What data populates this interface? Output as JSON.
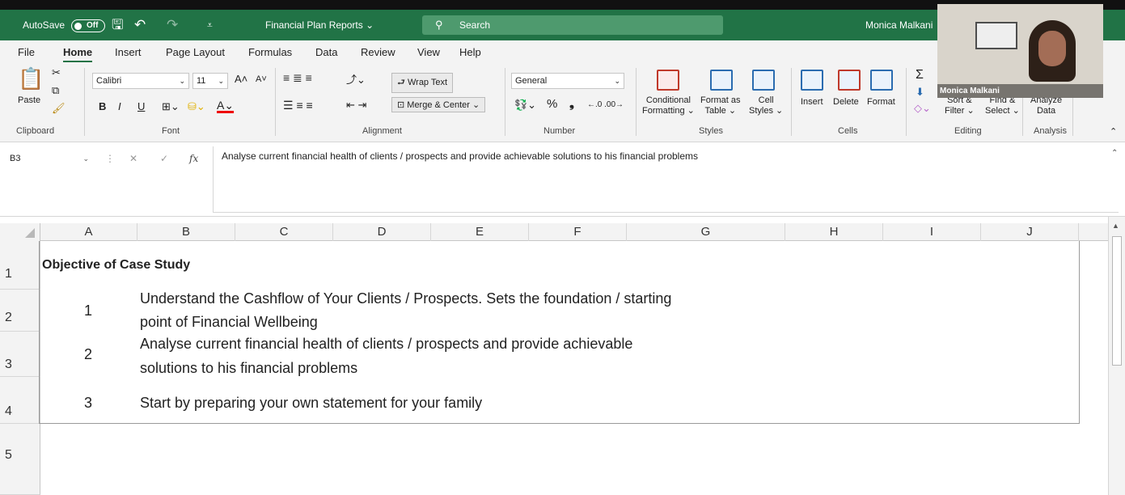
{
  "titlebar": {
    "autosave_label": "AutoSave",
    "autosave_state": "Off",
    "doc_title": "Financial Plan Reports",
    "doc_title_chevron": "⌄",
    "search_placeholder": "Search",
    "user_name": "Monica Malkani",
    "bg_color": "#217346"
  },
  "menu": [
    "File",
    "Home",
    "Insert",
    "Page Layout",
    "Formulas",
    "Data",
    "Review",
    "View",
    "Help"
  ],
  "menu_active": "Home",
  "ribbon": {
    "clipboard": {
      "paste": "Paste",
      "group": "Clipboard"
    },
    "font": {
      "name": "Calibri",
      "size": "11",
      "bold": "B",
      "italic": "I",
      "underline": "U",
      "group": "Font"
    },
    "alignment": {
      "wrap_text": "Wrap Text",
      "merge_center": "Merge & Center",
      "group": "Alignment"
    },
    "number": {
      "format": "General",
      "percent": "%",
      "comma": "❟",
      "group": "Number"
    },
    "styles": {
      "conditional": "Conditional",
      "formatting": "Formatting",
      "format_as": "Format as",
      "table": "Table",
      "cell": "Cell",
      "styles": "Styles",
      "group": "Styles"
    },
    "cells": {
      "insert": "Insert",
      "delete": "Delete",
      "format": "Format",
      "group": "Cells"
    },
    "editing": {
      "sort": "Sort &",
      "filter": "Filter",
      "find": "Find &",
      "select": "Select",
      "group": "Editing"
    },
    "analysis": {
      "analyze": "Analyze",
      "data": "Data",
      "group": "Analysis"
    }
  },
  "formula_bar": {
    "name_box": "B3",
    "fx": "fx",
    "content": "Analyse current financial health of clients / prospects and provide achievable solutions to his financial problems"
  },
  "columns": [
    "A",
    "B",
    "C",
    "D",
    "E",
    "F",
    "G",
    "H",
    "I",
    "J"
  ],
  "rows": [
    "1",
    "2",
    "3",
    "4",
    "5"
  ],
  "cells": {
    "a1": "Objective of Case Study",
    "n1": "1",
    "t1a": "Understand the Cashflow of Your Clients / Prospects. Sets the foundation / starting",
    "t1b": "point of Financial Wellbeing",
    "n2": "2",
    "t2a": "Analyse current financial health of clients / prospects and provide achievable",
    "t2b": "solutions to his financial problems",
    "n3": "3",
    "t3": "Start by preparing your own statement for your family"
  },
  "webcam": {
    "name": "Monica Malkani"
  }
}
